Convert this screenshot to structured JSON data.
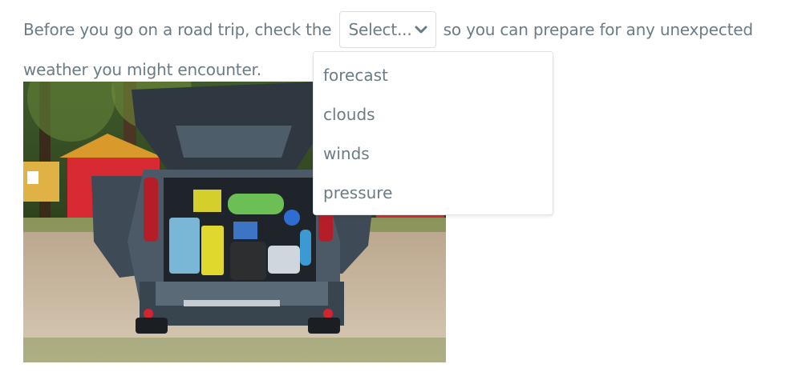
{
  "question": {
    "text_before": "Before you go on a road trip, check the",
    "text_after": "so you can prepare for any unexpected weather you might encounter."
  },
  "select": {
    "current_value": "Select...",
    "icon": "chevron-down-icon",
    "options": [
      "forecast",
      "clouds",
      "winds",
      "pressure"
    ]
  },
  "image": {
    "subject": "open car trunk packed with camping gear"
  },
  "colors": {
    "text": "#6b7c86",
    "border": "#d8dee2"
  }
}
